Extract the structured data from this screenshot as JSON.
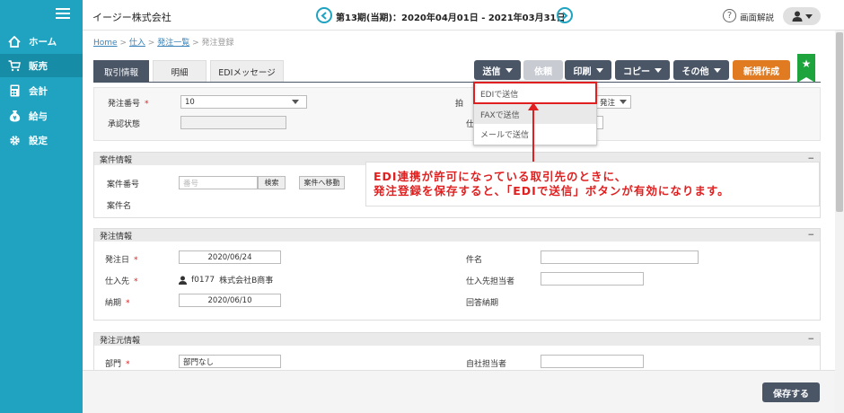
{
  "sidebar": {
    "items": [
      {
        "label": "ホーム",
        "icon": "home-icon"
      },
      {
        "label": "販売",
        "icon": "cart-icon"
      },
      {
        "label": "会計",
        "icon": "calculator-icon"
      },
      {
        "label": "給与",
        "icon": "money-bag-icon"
      },
      {
        "label": "設定",
        "icon": "gear-icon"
      }
    ],
    "active_index": 1
  },
  "header": {
    "company": "イージー株式会社",
    "period": "第13期(当期)：2020年04月01日 - 2021年03月31日",
    "help_label": "画面解説"
  },
  "breadcrumb": {
    "home": "Home",
    "sales": "仕入",
    "list": "発注一覧",
    "current": "発注登録",
    "sep": ">"
  },
  "tabs": [
    "取引情報",
    "明細",
    "EDIメッセージ"
  ],
  "toolbar": {
    "send": "送信",
    "request": "依頼",
    "print": "印刷",
    "copy": "コピー",
    "other": "その他",
    "new": "新規作成"
  },
  "dropdown": {
    "items": [
      "EDIで送信",
      "FAXで送信",
      "メールで送信"
    ]
  },
  "annotation": {
    "line1": "EDI連携が許可になっている取引先のときに、",
    "line2": "発注登録を保存すると、「EDIで送信」ボタンが有効になります。"
  },
  "top_section": {
    "order_no_label": "発注番号",
    "order_no_value": "10",
    "approval_label": "承認状態",
    "partial_label_1": "拍",
    "partial_value": "発注",
    "partial_label_2": "仕"
  },
  "project": {
    "title": "案件情報",
    "collapse": "−",
    "no_label": "案件番号",
    "no_placeholder": "番号",
    "search_btn": "検索",
    "goto_btn": "案件へ移動",
    "name_label": "案件名"
  },
  "order": {
    "title": "発注情報",
    "collapse": "−",
    "date_label": "発注日",
    "date_value": "2020/06/24",
    "supplier_label": "仕入先",
    "supplier_code": "f0177",
    "supplier_name": "株式会社B商事",
    "due_label": "納期",
    "due_value": "2020/06/10",
    "subject_label": "件名",
    "supplier_contact_label": "仕入先担当者",
    "reply_due_label": "回答納期"
  },
  "source": {
    "title": "発注元情報",
    "collapse": "−",
    "dept_label": "部門",
    "dept_value": "部門なし",
    "staff_label": "自社担当者"
  },
  "required_mark": "*",
  "save_label": "保存する",
  "colors": {
    "sidebar": "#1fa3c0",
    "dark_button": "#4a5566",
    "new_button": "#e07b22",
    "annotation": "#e02020",
    "star": "#1ea43c"
  }
}
